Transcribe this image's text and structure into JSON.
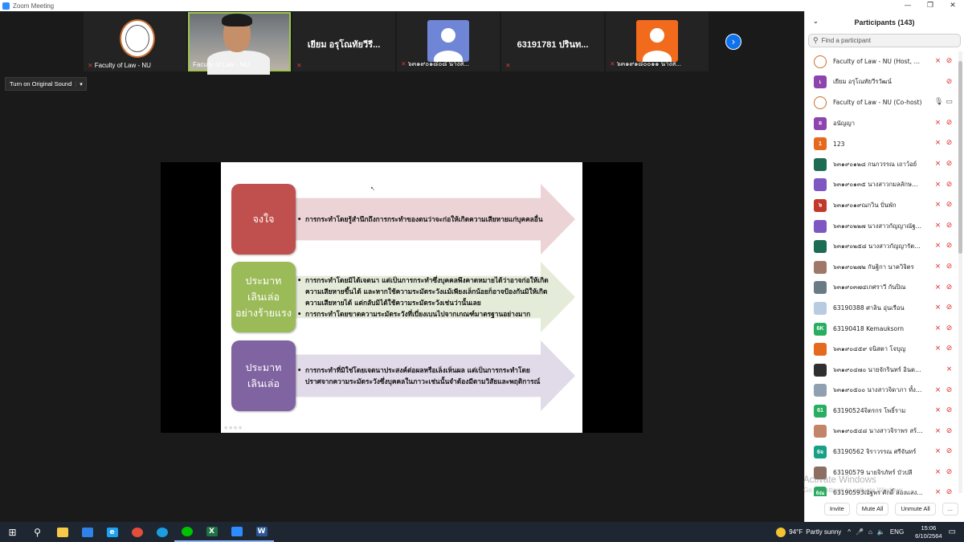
{
  "window": {
    "title": "Zoom Meeting",
    "controls": [
      "—",
      "❐",
      "✕"
    ]
  },
  "thumbnails": [
    {
      "type": "logo",
      "name": "Faculty of Law - NU",
      "muted": true,
      "active": false
    },
    {
      "type": "video",
      "name": "Faculty of Law - NU",
      "muted": false,
      "active": true
    },
    {
      "type": "text",
      "display": "เยียม อรุโณทัยวีรี...",
      "muted": true,
      "active": false
    },
    {
      "type": "avatar",
      "color": "#6f86d6",
      "name": "๖๓๑๙๐๑๘๐๘ นางส...",
      "muted": true,
      "active": false
    },
    {
      "type": "text",
      "display": "63191781 ปรินท...",
      "muted": true,
      "active": false
    },
    {
      "type": "avatar",
      "color": "#f26b1d",
      "name": "๖๓๑๙๑๘๐๐๑๑ นางส...",
      "muted": true,
      "active": false
    }
  ],
  "next_page_icon": "›",
  "original_sound": {
    "label": "Turn on Original Sound",
    "dropdown_icon": "▾"
  },
  "slide": {
    "rows": [
      {
        "label": "จงใจ",
        "box_color": "#c0504d",
        "arrow_color": "#ecd3d6",
        "bullets": [
          "การกระทำโดยรู้สำนึกถึงการกระทำของตนว่าจะก่อให้เกิดความเสียหายแก่บุคคลอื่น"
        ]
      },
      {
        "label": "ประมาท\nเลินเล่อ\nอย่างร้ายแรง",
        "box_color": "#9bbb59",
        "arrow_color": "#e5ebd9",
        "bullets": [
          "การกระทำโดยมิได้เจตนา แต่เป็นการกระทำซึ่งบุคคลพึงคาดหมายได้ว่าอาจก่อให้เกิดความเสียหายขึ้นได้ และหากใช้ความระมัดระวังแม้เพียงเล็กน้อยก็อาจป้องกันมิให้เกิดความเสียหายได้ แต่กลับมิได้ใช้ความระมัดระวังเช่นว่านั้นเลย",
          "การกระทำโดยขาดความระมัดระวังที่เบี่ยงเบนไปจากเกณฑ์มาตรฐานอย่างมาก"
        ]
      },
      {
        "label": "ประมาท\nเลินเล่อ",
        "box_color": "#8064a2",
        "arrow_color": "#e1dae9",
        "bullets": [
          "การกระทำที่มิใช่โดยเจตนาประสงค์ต่อผลหรือเล็งเห็นผล แต่เป็นการกระทำโดยปราศจากความระมัดระวังซึ่งบุคคลในภาวะเช่นนั้นจำต้องมีตามวิสัยและพฤติการณ์"
        ]
      }
    ]
  },
  "participants": {
    "title": "Participants (143)",
    "collapse_icon": "⌄",
    "search_placeholder": "Find a participant",
    "list": [
      {
        "name": "Faculty of Law - NU (Host, me)",
        "avatar": "logo",
        "color": "#ffffff",
        "mic": "muted",
        "cam": "off"
      },
      {
        "name": "เยียม อรุโณทัยวีรวัฒน์",
        "avatar": "เ",
        "color": "#8e44ad",
        "mic": "share",
        "cam": "off"
      },
      {
        "name": "Faculty of Law - NU (Co-host)",
        "avatar": "logo",
        "color": "#ffffff",
        "mic": "on",
        "cam": "on"
      },
      {
        "name": "อนัญญา",
        "avatar": "อ",
        "color": "#8e44ad",
        "mic": "muted",
        "cam": "off"
      },
      {
        "name": "123",
        "avatar": "1",
        "color": "#e66a1e",
        "mic": "muted",
        "cam": "off"
      },
      {
        "name": "๖๓๑๙๐๑๒๘ กนกวรรณ เถาว้อย์",
        "avatar": "photo",
        "color": "#1e6b53",
        "mic": "muted",
        "cam": "off"
      },
      {
        "name": "๖๓๑๙๐๑๓๕ นางสาวกมลลักษณ์ ค...",
        "avatar": "photo",
        "color": "#7e57c2",
        "mic": "muted",
        "cam": "off"
      },
      {
        "name": "๖๓๑๙๐๑๙ณกวิน ปั่นพัก",
        "avatar": "๖",
        "color": "#c0392b",
        "mic": "muted",
        "cam": "off"
      },
      {
        "name": "๖๓๑๙๐๒๒๗ นางสาวกัญญาณัฐ แ...",
        "avatar": "photo",
        "color": "#7e57c2",
        "mic": "muted",
        "cam": "off"
      },
      {
        "name": "๖๓๑๙๐๒๕๘ นางสาวกัญญารัตน์ ...",
        "avatar": "photo",
        "color": "#1e6b53",
        "mic": "muted",
        "cam": "off"
      },
      {
        "name": "๖๓๑๙๐๒๗๒ กันฐิกา นาควิจิตร",
        "avatar": "photo",
        "color": "#a0786a",
        "mic": "muted",
        "cam": "off"
      },
      {
        "name": "๖๓๑๙๐๓๗๔เกศราวี กันปิณ",
        "avatar": "photo",
        "color": "#6b7b86",
        "mic": "muted",
        "cam": "off"
      },
      {
        "name": "63190388 ศาลิน อุ่นเรือน",
        "avatar": "photo",
        "color": "#b8cbe0",
        "mic": "muted",
        "cam": "off"
      },
      {
        "name": "63190418 Kemauksorn",
        "avatar": "6K",
        "color": "#27ae60",
        "mic": "muted",
        "cam": "off"
      },
      {
        "name": "๖๓๑๙๐๔๕๙ จนิสตา โจบุญ",
        "avatar": "photo",
        "color": "#e66a1e",
        "mic": "muted",
        "cam": "off"
      },
      {
        "name": "๖๓๑๙๐๔๗๐ นายจักรินทร์ อินตามูล",
        "avatar": "photo",
        "color": "#2f2f2f",
        "mic": "muted",
        "cam": "none"
      },
      {
        "name": "๖๓๑๙๐๕๐๐ นางสาวจิดาภา ทั้งไชย",
        "avatar": "photo",
        "color": "#8fa0b0",
        "mic": "muted",
        "cam": "off"
      },
      {
        "name": "63190524จิตรกร โพธิ์ราม",
        "avatar": "61",
        "color": "#27ae60",
        "mic": "muted",
        "cam": "off"
      },
      {
        "name": "๖๓๑๙๐๕๔๘ นางสาวจิราพร สร้อย...",
        "avatar": "photo",
        "color": "#c2856a",
        "mic": "muted",
        "cam": "off"
      },
      {
        "name": "63190562 จิราวรรณ ศรีจันทร์",
        "avatar": "6จ",
        "color": "#16a085",
        "mic": "muted",
        "cam": "off"
      },
      {
        "name": "63190579 นายจิรภัทร์ บัวปลี",
        "avatar": "photo",
        "color": "#8d6e63",
        "mic": "muted",
        "cam": "off"
      },
      {
        "name": "63190593ณัฐพร ศักดิ์ ส่องแสงจันทร์",
        "avatar": "6ณ",
        "color": "#27ae60",
        "mic": "muted",
        "cam": "off"
      }
    ],
    "footer": {
      "invite": "Invite",
      "mute_all": "Mute All",
      "unmute_all": "Unmute All",
      "more": "..."
    }
  },
  "watermark": {
    "line1": "Activate Windows",
    "line2": "Go to Settings to activate Windows."
  },
  "taskbar": {
    "apps": [
      {
        "name": "windows-start",
        "glyph": "⊞",
        "color": "#ffffff"
      },
      {
        "name": "search",
        "glyph": "⚲",
        "color": "#ffffff"
      },
      {
        "name": "file-explorer",
        "glyph": "",
        "color": "#f7c948"
      },
      {
        "name": "mail",
        "glyph": "",
        "color": "#2f82e8"
      },
      {
        "name": "internet-explorer",
        "glyph": "e",
        "color": "#1ea1f2"
      },
      {
        "name": "chrome",
        "glyph": "",
        "color": "#e44d3a"
      },
      {
        "name": "edge",
        "glyph": "",
        "color": "#1b9de2"
      },
      {
        "name": "line",
        "glyph": "",
        "color": "#00c300"
      },
      {
        "name": "excel",
        "glyph": "X",
        "color": "#1f7244"
      },
      {
        "name": "zoom",
        "glyph": "",
        "color": "#2d8cff"
      },
      {
        "name": "word",
        "glyph": "W",
        "color": "#2b5797"
      }
    ],
    "weather": {
      "temp": "94°F",
      "desc": "Partly sunny"
    },
    "tray": {
      "caret": "^",
      "lang": "ENG"
    },
    "clock": {
      "time": "15:06",
      "date": "6/10/2564"
    },
    "notification_icon": "▭"
  }
}
